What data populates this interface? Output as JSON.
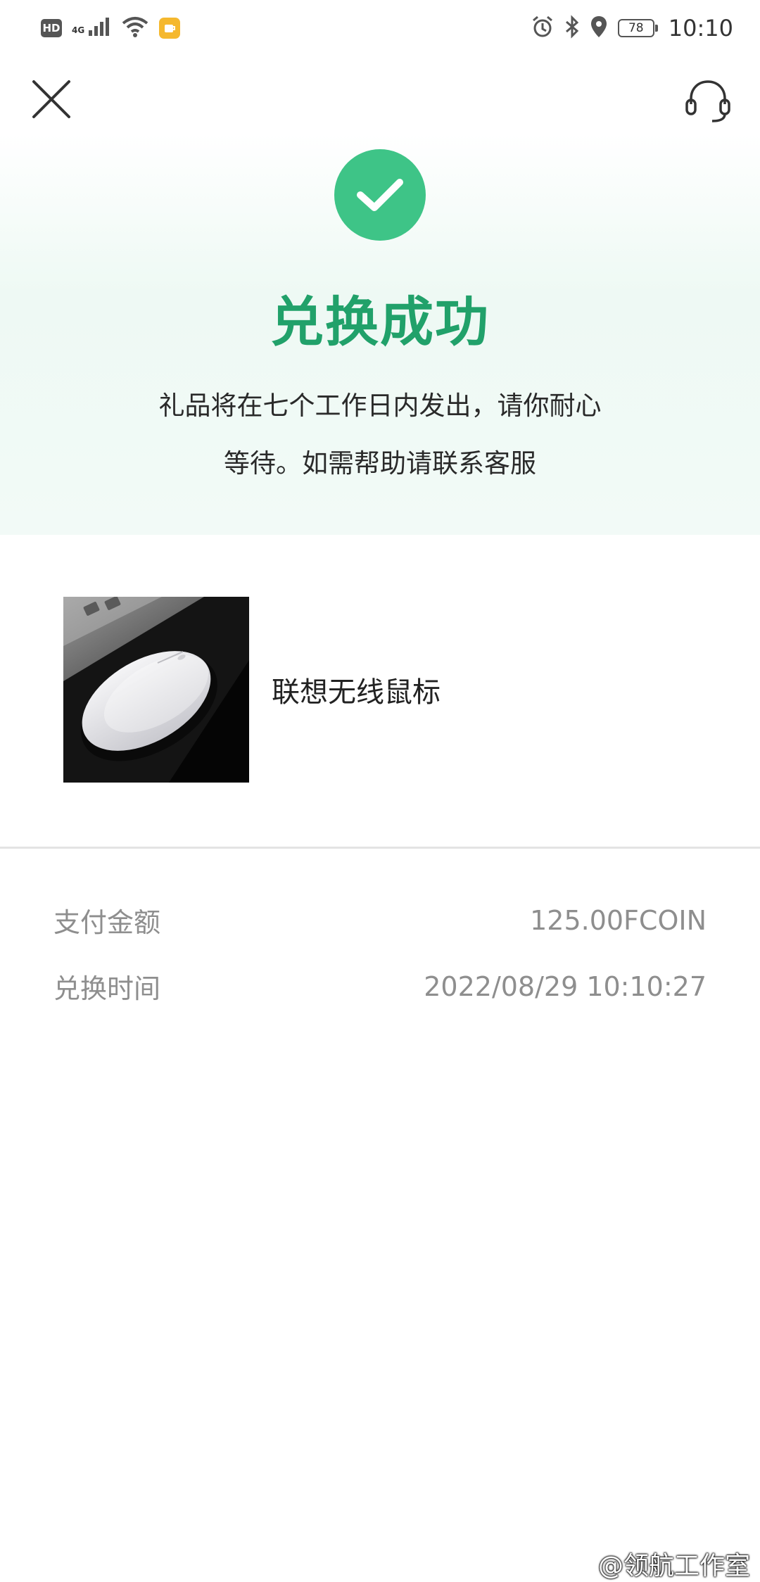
{
  "status_bar": {
    "hd": "HD",
    "network": "4G",
    "battery": "78",
    "time": "10:10"
  },
  "header": {
    "close_icon": "close-icon",
    "service_icon": "headset-icon"
  },
  "hero": {
    "title": "兑换成功",
    "subtitle": "礼品将在七个工作日内发出，请你耐心等待。如需帮助请联系客服"
  },
  "product": {
    "name": "联想无线鼠标"
  },
  "details": [
    {
      "label": "支付金额",
      "value": "125.00FCOIN"
    },
    {
      "label": "兑换时间",
      "value": "2022/08/29 10:10:27"
    }
  ],
  "watermark": "@领航工作室",
  "colors": {
    "accent": "#3ec487",
    "title": "#21a16a",
    "muted_text": "#8e8e8e"
  }
}
